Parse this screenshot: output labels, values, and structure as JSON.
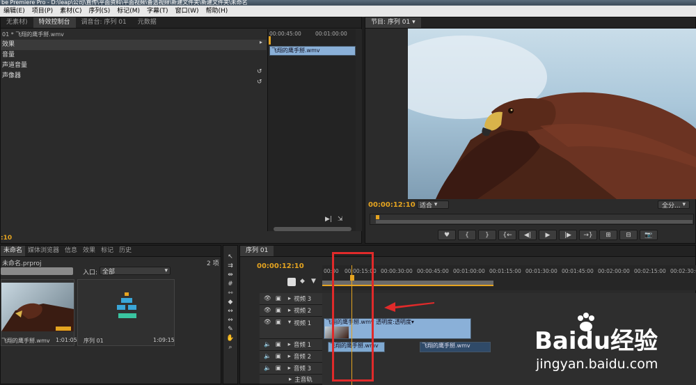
{
  "window": {
    "title": "be Premiere Pro - D:\\leap\\公司\\直传\\平面资料\\平面视频\\备选视频\\新建文件夹\\新建文件夹\\未命名"
  },
  "menu": [
    "编辑(E)",
    "项目(P)",
    "素材(C)",
    "序列(S)",
    "标记(M)",
    "字幕(T)",
    "窗口(W)",
    "帮助(H)"
  ],
  "effect_panel": {
    "tabs": [
      "无素材)",
      "特效控制台",
      "调音台: 序列 01",
      "元数据"
    ],
    "active_tab": 1,
    "clip_title": "01 * 飞翔的鹰手掰.wmv",
    "rows": [
      "效果",
      "音量",
      "声道音量",
      "声像器"
    ],
    "ruler": [
      "00:00:45:00",
      "00:01:00:00"
    ],
    "clip": "飞翔的鹰手掰.wmv",
    "timecode": ":10"
  },
  "program": {
    "tab": "节目: 序列 01",
    "timecode": "00:00:12:10",
    "fit": "适合",
    "quality": "全分...",
    "controls": [
      "♥",
      "{",
      "}",
      "{←",
      "◀|",
      "▶",
      "|▶",
      "→}",
      "⊞",
      "⊟",
      "📷"
    ]
  },
  "project": {
    "tabs": [
      "未命名",
      "媒体浏览器",
      "信息",
      "效果",
      "标记",
      "历史"
    ],
    "file": "未命名.prproj",
    "count": "2 项",
    "inpoint_label": "入口:",
    "inpoint_value": "全部",
    "items": [
      {
        "name": "飞翔的鹰手掰.wmv",
        "duration": "1:01:05"
      },
      {
        "name": "序列 01",
        "duration": "1:09:15"
      }
    ]
  },
  "sequence": {
    "tab": "序列 01",
    "timecode": "00:00:12:10",
    "ruler": [
      "00:00",
      "00:00:15:00",
      "00:00:30:00",
      "00:00:45:00",
      "00:01:00:00",
      "00:01:15:00",
      "00:01:30:00",
      "00:01:45:00",
      "00:02:00:00",
      "00:02:15:00",
      "00:02:30:00"
    ],
    "tracks": [
      "视频 3",
      "视频 2",
      "视频 1",
      "音频 1",
      "音频 2",
      "音频 3",
      "主音轨"
    ],
    "video_clip": "飞翔的鹰手掰.wmv 透明度:透明度▾",
    "audio_clip_a": "飞翔的鹰手掰.wmv",
    "audio_clip_b": "飞翔的鹰手掰.wmv"
  },
  "watermark": {
    "logo": "Baidu经验",
    "url": "jingyan.baidu.com"
  },
  "colors": {
    "accent": "#e5a420",
    "clip": "#8ab0d8",
    "highlight": "#e02a2a"
  }
}
